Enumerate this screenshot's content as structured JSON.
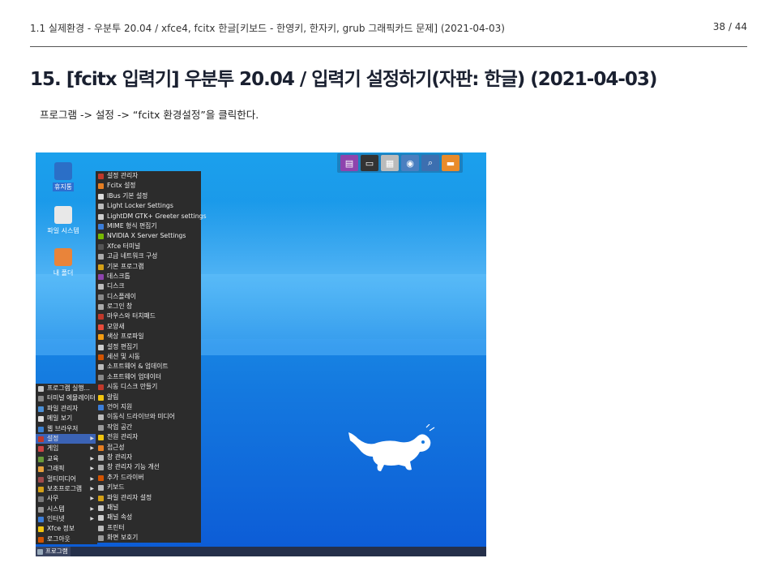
{
  "header": {
    "breadcrumb": "1.1 실제환경 - 우분투 20.04 / xfce4, fcitx 한글[키보드 - 한영키, 한자키, grub 그래픽카드 문제] (2021-04-03)",
    "page_number": "38 / 44"
  },
  "title": "15. [fcitx 입력기] 우분투 20.04 / 입력기 설정하기(자판: 한글) (2021-04-03)",
  "description": "프로그램 -> 설정 -> “fcitx 환경설정”을 클릭한다.",
  "screenshot": {
    "desktop_icons": [
      {
        "label": "휴지통",
        "color": "#2b6fc7"
      },
      {
        "label": "파일 시스템",
        "color": "#e8e8e8"
      },
      {
        "label": "내 폴더",
        "color": "#e9843a"
      }
    ],
    "panel_icons": [
      "app-icon",
      "terminal-icon",
      "files-icon",
      "browser-icon",
      "search-icon",
      "folder-icon"
    ],
    "left_menu": [
      {
        "label": "프로그램 실행...",
        "icon_color": "#c8c8c8"
      },
      {
        "label": "터미널 에뮬레이터",
        "icon_color": "#888888"
      },
      {
        "label": "파일 관리자",
        "icon_color": "#4a8fd6"
      },
      {
        "label": "메일 보기",
        "icon_color": "#dddddd"
      },
      {
        "label": "웹 브라우저",
        "icon_color": "#3a7fd0"
      },
      {
        "label": "설정",
        "icon_color": "#c0392b",
        "arrow": true,
        "active": true
      },
      {
        "label": "게임",
        "icon_color": "#cc4444",
        "arrow": true
      },
      {
        "label": "교육",
        "icon_color": "#6a9a3a",
        "arrow": true
      },
      {
        "label": "그래픽",
        "icon_color": "#e6a23c",
        "arrow": true
      },
      {
        "label": "멀티미디어",
        "icon_color": "#a04a4a",
        "arrow": true
      },
      {
        "label": "보조프로그램",
        "icon_color": "#d4a017",
        "arrow": true
      },
      {
        "label": "사무",
        "icon_color": "#7a7a7a",
        "arrow": true
      },
      {
        "label": "시스템",
        "icon_color": "#999999",
        "arrow": true
      },
      {
        "label": "인터넷",
        "icon_color": "#3b7dd8",
        "arrow": true
      },
      {
        "label": "Xfce 정보",
        "icon_color": "#f1c40f"
      },
      {
        "label": "로그아웃",
        "icon_color": "#d35400"
      }
    ],
    "settings_menu": [
      {
        "label": "설정 관리자",
        "icon_color": "#c0392b"
      },
      {
        "label": "Fcitx 설정",
        "icon_color": "#e67e22"
      },
      {
        "label": "IBus 기본 설정",
        "icon_color": "#dddddd"
      },
      {
        "label": "Light Locker Settings",
        "icon_color": "#bbbbbb"
      },
      {
        "label": "LightDM GTK+ Greeter settings",
        "icon_color": "#cccccc"
      },
      {
        "label": "MIME 형식 편집기",
        "icon_color": "#3b7dd8"
      },
      {
        "label": "NVIDIA X Server Settings",
        "icon_color": "#76b900"
      },
      {
        "label": "Xfce 터미널",
        "icon_color": "#555555"
      },
      {
        "label": "고급 네트워크 구성",
        "icon_color": "#aaaaaa"
      },
      {
        "label": "기본 프로그램",
        "icon_color": "#d4a017"
      },
      {
        "label": "데스크톱",
        "icon_color": "#8e44ad"
      },
      {
        "label": "디스크",
        "icon_color": "#bbbbbb"
      },
      {
        "label": "디스플레이",
        "icon_color": "#888888"
      },
      {
        "label": "로그인 창",
        "icon_color": "#aaaaaa"
      },
      {
        "label": "마우스와 터치패드",
        "icon_color": "#c0392b"
      },
      {
        "label": "모양새",
        "icon_color": "#e74c3c"
      },
      {
        "label": "색상 프로파일",
        "icon_color": "#f39c12"
      },
      {
        "label": "설정 편집기",
        "icon_color": "#cccccc"
      },
      {
        "label": "세션 및 시동",
        "icon_color": "#d35400"
      },
      {
        "label": "소프트웨어 & 업데이트",
        "icon_color": "#bbbbbb"
      },
      {
        "label": "소프트웨어 업데이터",
        "icon_color": "#888888"
      },
      {
        "label": "시동 디스크 만들기",
        "icon_color": "#c0392b"
      },
      {
        "label": "알림",
        "icon_color": "#f1c40f"
      },
      {
        "label": "언어 지원",
        "icon_color": "#3b7dd8"
      },
      {
        "label": "이동식 드라이브와 미디어",
        "icon_color": "#bbbbbb"
      },
      {
        "label": "작업 공간",
        "icon_color": "#999999"
      },
      {
        "label": "전원 관리자",
        "icon_color": "#f1c40f"
      },
      {
        "label": "접근성",
        "icon_color": "#e67e22"
      },
      {
        "label": "창 관리자",
        "icon_color": "#bbbbbb"
      },
      {
        "label": "창 관리자 기능 개선",
        "icon_color": "#aaaaaa"
      },
      {
        "label": "추가 드라이버",
        "icon_color": "#d35400"
      },
      {
        "label": "키보드",
        "icon_color": "#bbbbbb"
      },
      {
        "label": "파일 관리자 설정",
        "icon_color": "#d4a017"
      },
      {
        "label": "패널",
        "icon_color": "#cccccc"
      },
      {
        "label": "패널 속성",
        "icon_color": "#cccccc"
      },
      {
        "label": "프린터",
        "icon_color": "#bbbbbb"
      },
      {
        "label": "화면 보호기",
        "icon_color": "#999999"
      }
    ],
    "taskbar_button": "프로그램"
  }
}
